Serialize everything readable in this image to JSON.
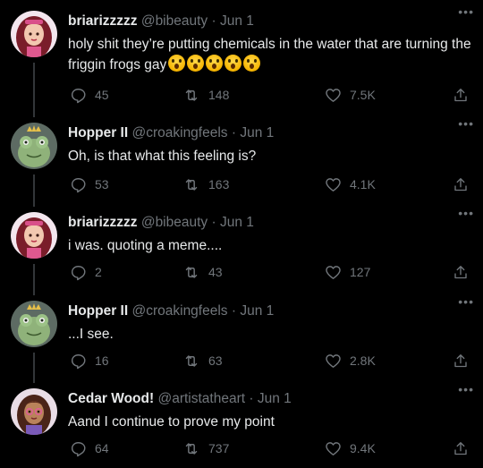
{
  "tweets": [
    {
      "name": "briarizzzzz",
      "handle": "@bibeauty",
      "separator": "·",
      "date": "Jun 1",
      "text": "holy shit they’re putting chemicals in the water that are turning the friggin frogs gay",
      "emoji_count": 5,
      "emoji_icon": "screaming-face-emoji",
      "replies": "45",
      "retweets": "148",
      "likes": "7.5K",
      "avatar_icon": "briar-avatar"
    },
    {
      "name": "Hopper II",
      "handle": "@croakingfeels",
      "separator": "·",
      "date": "Jun 1",
      "text": "Oh, is that what this feeling is?",
      "replies": "53",
      "retweets": "163",
      "likes": "4.1K",
      "avatar_icon": "frog-prince-avatar"
    },
    {
      "name": "briarizzzzz",
      "handle": "@bibeauty",
      "separator": "·",
      "date": "Jun 1",
      "text": "i was. quoting a meme....",
      "replies": "2",
      "retweets": "43",
      "likes": "127",
      "avatar_icon": "briar-avatar"
    },
    {
      "name": "Hopper II",
      "handle": "@croakingfeels",
      "separator": "·",
      "date": "Jun 1",
      "text": "...I see.",
      "replies": "16",
      "retweets": "63",
      "likes": "2.8K",
      "avatar_icon": "frog-prince-avatar"
    },
    {
      "name": "Cedar Wood!",
      "handle": "@artistatheart",
      "separator": "·",
      "date": "Jun 1",
      "text": "Aand I continue to prove my point",
      "replies": "64",
      "retweets": "737",
      "likes": "9.4K",
      "avatar_icon": "cedar-avatar"
    }
  ],
  "icons": {
    "reply": "reply-icon",
    "retweet": "retweet-icon",
    "like": "heart-icon",
    "share": "share-icon",
    "more": "more-options-icon"
  },
  "more_glyph": "•••",
  "colors": {
    "background": "#000000",
    "primary_text": "#e7e9ea",
    "secondary_text": "#71767b",
    "thread_line": "#333639"
  }
}
